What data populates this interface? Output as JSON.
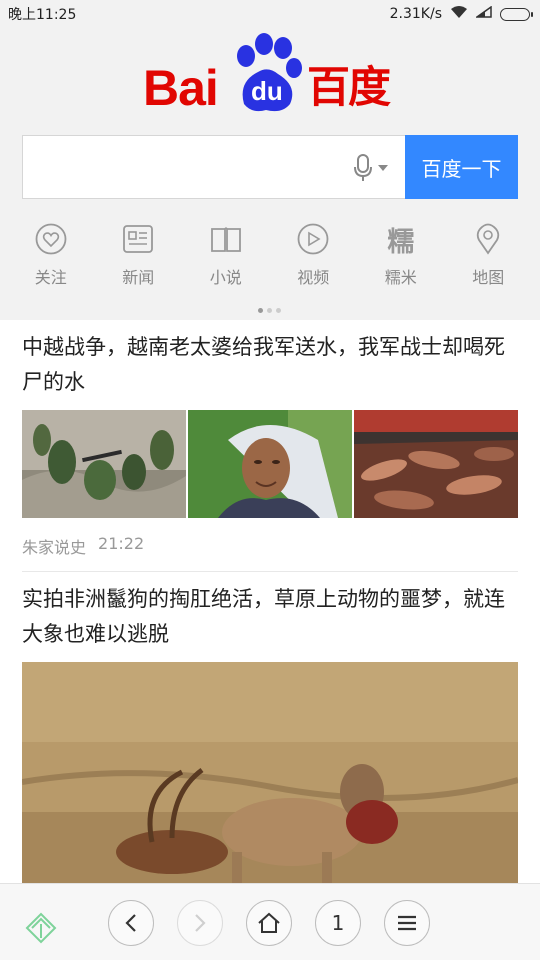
{
  "status": {
    "time": "晚上11:25",
    "speed": "2.31K/s"
  },
  "logo": {
    "latin": "Bai",
    "badge": "du",
    "chinese": "百度",
    "color": "#e10602"
  },
  "search": {
    "value": "",
    "button_label": "百度一下",
    "button_color": "#3388ff",
    "mic_icon": "microphone-icon"
  },
  "quick_nav": [
    {
      "label": "关注",
      "icon": "heart-icon"
    },
    {
      "label": "新闻",
      "icon": "newspaper-icon"
    },
    {
      "label": "小说",
      "icon": "book-icon"
    },
    {
      "label": "视频",
      "icon": "play-icon"
    },
    {
      "label": "糯米",
      "icon": "nuomi-icon",
      "glyph": "糯"
    },
    {
      "label": "地图",
      "icon": "map-pin-icon"
    }
  ],
  "feed": [
    {
      "title": "中越战争，越南老太婆给我军送水，我军战士却喝死尸的水",
      "images": [
        "soldiers-photo",
        "old-woman-photo",
        "bodies-photo"
      ],
      "source": "朱家说史",
      "time": "21:22"
    },
    {
      "title": "实拍非洲鬣狗的掏肛绝活，草原上动物的噩梦，就连大象也难以逃脱",
      "images": [
        "hyena-antelope-photo"
      ]
    }
  ],
  "bottom_bar": {
    "tab_count": "1"
  }
}
